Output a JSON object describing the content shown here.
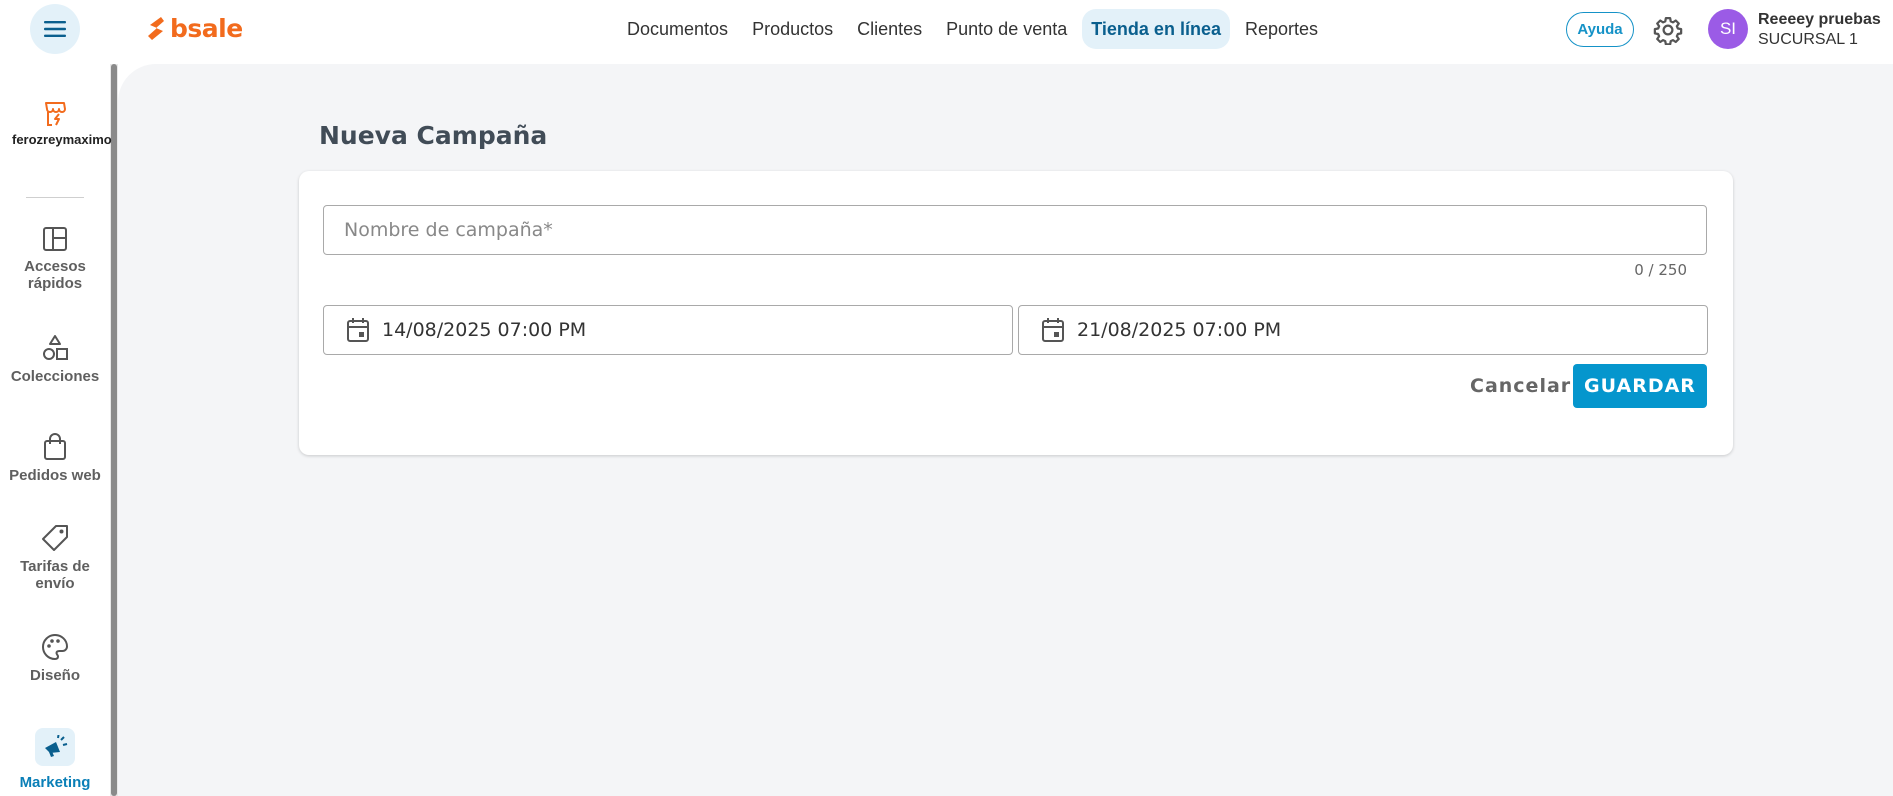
{
  "brand": {
    "logo_text": "bsale",
    "color": "#f26b1d"
  },
  "nav": {
    "items": [
      {
        "label": "Documentos",
        "active": false
      },
      {
        "label": "Productos",
        "active": false
      },
      {
        "label": "Clientes",
        "active": false
      },
      {
        "label": "Punto de venta",
        "active": false
      },
      {
        "label": "Tienda en línea",
        "active": true
      },
      {
        "label": "Reportes",
        "active": false
      }
    ]
  },
  "header": {
    "help_label": "Ayuda",
    "avatar_initials": "SI",
    "user_name": "Reeeey pruebas",
    "branch": "SUCURSAL 1"
  },
  "sidebar": {
    "store_name": "ferozreymaximo",
    "items": [
      {
        "label": "Accesos rápidos",
        "icon": "layout-icon"
      },
      {
        "label": "Colecciones",
        "icon": "shapes-icon"
      },
      {
        "label": "Pedidos web",
        "icon": "shopping-bag-icon"
      },
      {
        "label": "Tarifas de envío",
        "icon": "tag-icon"
      },
      {
        "label": "Diseño",
        "icon": "palette-icon"
      },
      {
        "label": "Marketing",
        "icon": "megaphone-icon",
        "active": true
      }
    ]
  },
  "main": {
    "title": "Nueva Campaña",
    "form": {
      "name_placeholder": "Nombre de campaña*",
      "name_value": "",
      "counter": "0 / 250",
      "start_date": "14/08/2025 07:00 PM",
      "end_date": "21/08/2025 07:00 PM",
      "cancel_label": "Cancelar",
      "save_label": "GUARDAR"
    }
  },
  "colors": {
    "accent": "#0596cd",
    "background": "#f4f5f7",
    "avatar": "#9b5be6"
  }
}
